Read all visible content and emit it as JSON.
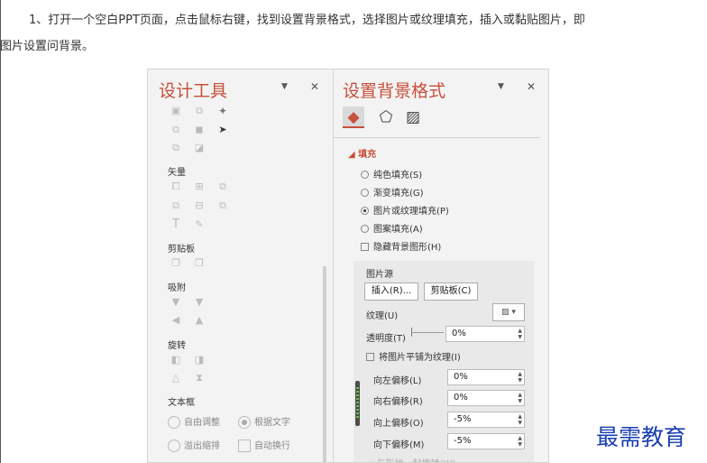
{
  "article": {
    "instruction_line1": "1、打开一个空白PPT页面，点击鼠标右键，找到设置背景格式，选择图片或纹理填充，插入或黏贴图片，即",
    "instruction_line2": "可将图片设置问背景。"
  },
  "design_panel": {
    "title": "设计工具",
    "sections": {
      "vector": "矢量",
      "clipboard": "剪贴板",
      "snap": "吸附",
      "rotate": "旋转",
      "textbox": "文本框"
    },
    "textbox_options": {
      "auto_adjust": "自由调整",
      "fit_text": "根据文字",
      "overflow_shrink": "溢出缩排",
      "auto_wrap": "自动换行"
    },
    "icons": [
      "dropdown-icon",
      "close-icon",
      "magic-wand-icon",
      "cursor-arrow-icon",
      "text-t-icon",
      "eyedropper-icon"
    ]
  },
  "format_panel": {
    "title": "设置背景格式",
    "tabs": [
      "fill-bucket-icon",
      "pentagon-icon",
      "picture-icon"
    ],
    "fill_section": "◢ 填充",
    "fill_options": [
      {
        "label": "纯色填充(S)",
        "type": "radio",
        "selected": false
      },
      {
        "label": "渐变填充(G)",
        "type": "radio",
        "selected": false
      },
      {
        "label": "图片或纹理填充(P)",
        "type": "radio",
        "selected": true
      },
      {
        "label": "图案填充(A)",
        "type": "radio",
        "selected": false
      },
      {
        "label": "隐藏背景图形(H)",
        "type": "checkbox",
        "selected": false
      }
    ],
    "picture_source": "图片源",
    "insert_button": "插入(R)...",
    "clipboard_button": "剪贴板(C)",
    "texture_label": "纹理(U)",
    "transparency_label": "透明度(T)",
    "transparency_value": "0%",
    "tile_label": "将图片平铺为纹理(I)",
    "offsets": [
      {
        "label": "向左偏移(L)",
        "value": "0%"
      },
      {
        "label": "向右偏移(R)",
        "value": "0%"
      },
      {
        "label": "向上偏移(O)",
        "value": "-5%"
      },
      {
        "label": "向下偏移(M)",
        "value": "-5%"
      }
    ],
    "rotate_with_shape": "与形状一起旋转(W)"
  },
  "watermark": "最需教育",
  "colors": {
    "accent": "#c8503b",
    "watermark": "#1a3eb0"
  }
}
